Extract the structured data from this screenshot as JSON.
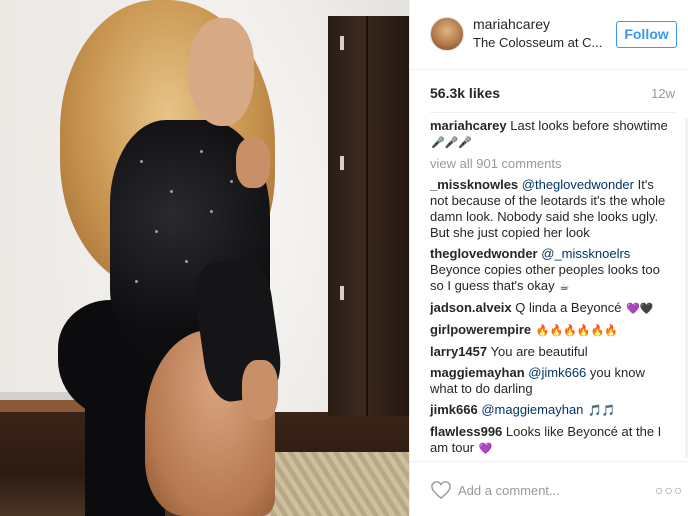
{
  "post": {
    "username": "mariahcarey",
    "location": "The Colosseum at C...",
    "follow_label": "Follow",
    "likes": "56.3k likes",
    "age": "12w",
    "caption_user": "mariahcarey",
    "caption_text": "Last looks before showtime",
    "caption_emoji": "🎤🎤🎤",
    "view_all": "view all 901 comments"
  },
  "comments": [
    {
      "user": "_missknowles",
      "mention": "@theglovedwonder",
      "text": "It's not because of the leotards it's the whole damn look. Nobody said she looks ugly. But she just copied her look",
      "emoji": ""
    },
    {
      "user": "theglovedwonder",
      "mention": "@_missknoelrs",
      "text": "Beyonce copies other peoples looks too so I guess that's okay",
      "emoji": "☕"
    },
    {
      "user": "jadson.alveix",
      "mention": "",
      "text": "Q linda a Beyoncé",
      "emoji": "💜🖤"
    },
    {
      "user": "girlpowerempire",
      "mention": "",
      "text": "",
      "emoji": "🔥🔥🔥🔥🔥🔥"
    },
    {
      "user": "larry1457",
      "mention": "",
      "text": "You are beautiful",
      "emoji": ""
    },
    {
      "user": "maggiemayhan",
      "mention": "@jimk666",
      "text": "you know what to do darling",
      "emoji": ""
    },
    {
      "user": "jimk666",
      "mention": "@maggiemayhan",
      "text": "",
      "emoji": "🎵🎵"
    },
    {
      "user": "flawless996",
      "mention": "",
      "text": "Looks like Beyoncé at the I am tour",
      "emoji": "💜"
    }
  ],
  "footer": {
    "add_comment_placeholder": "Add a comment...",
    "more": "○○○",
    "like_icon": "heart-outline-icon"
  },
  "colors": {
    "accent": "#3897f0",
    "mention": "#003569",
    "muted": "#999999"
  }
}
